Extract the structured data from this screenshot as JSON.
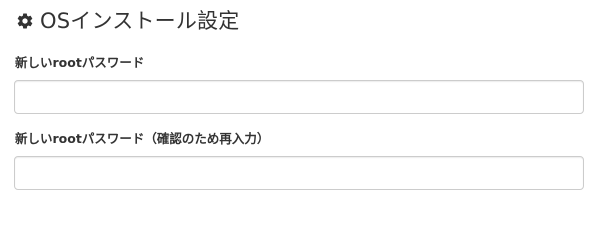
{
  "header": {
    "icon": "gear-icon",
    "title": "OSインストール設定"
  },
  "form": {
    "new_password": {
      "label": "新しいrootパスワード",
      "value": "",
      "placeholder": ""
    },
    "confirm_password": {
      "label": "新しいrootパスワード（確認のため再入力）",
      "value": "",
      "placeholder": ""
    }
  },
  "colors": {
    "text": "#333333",
    "input_border": "#cccccc",
    "background": "#ffffff"
  }
}
